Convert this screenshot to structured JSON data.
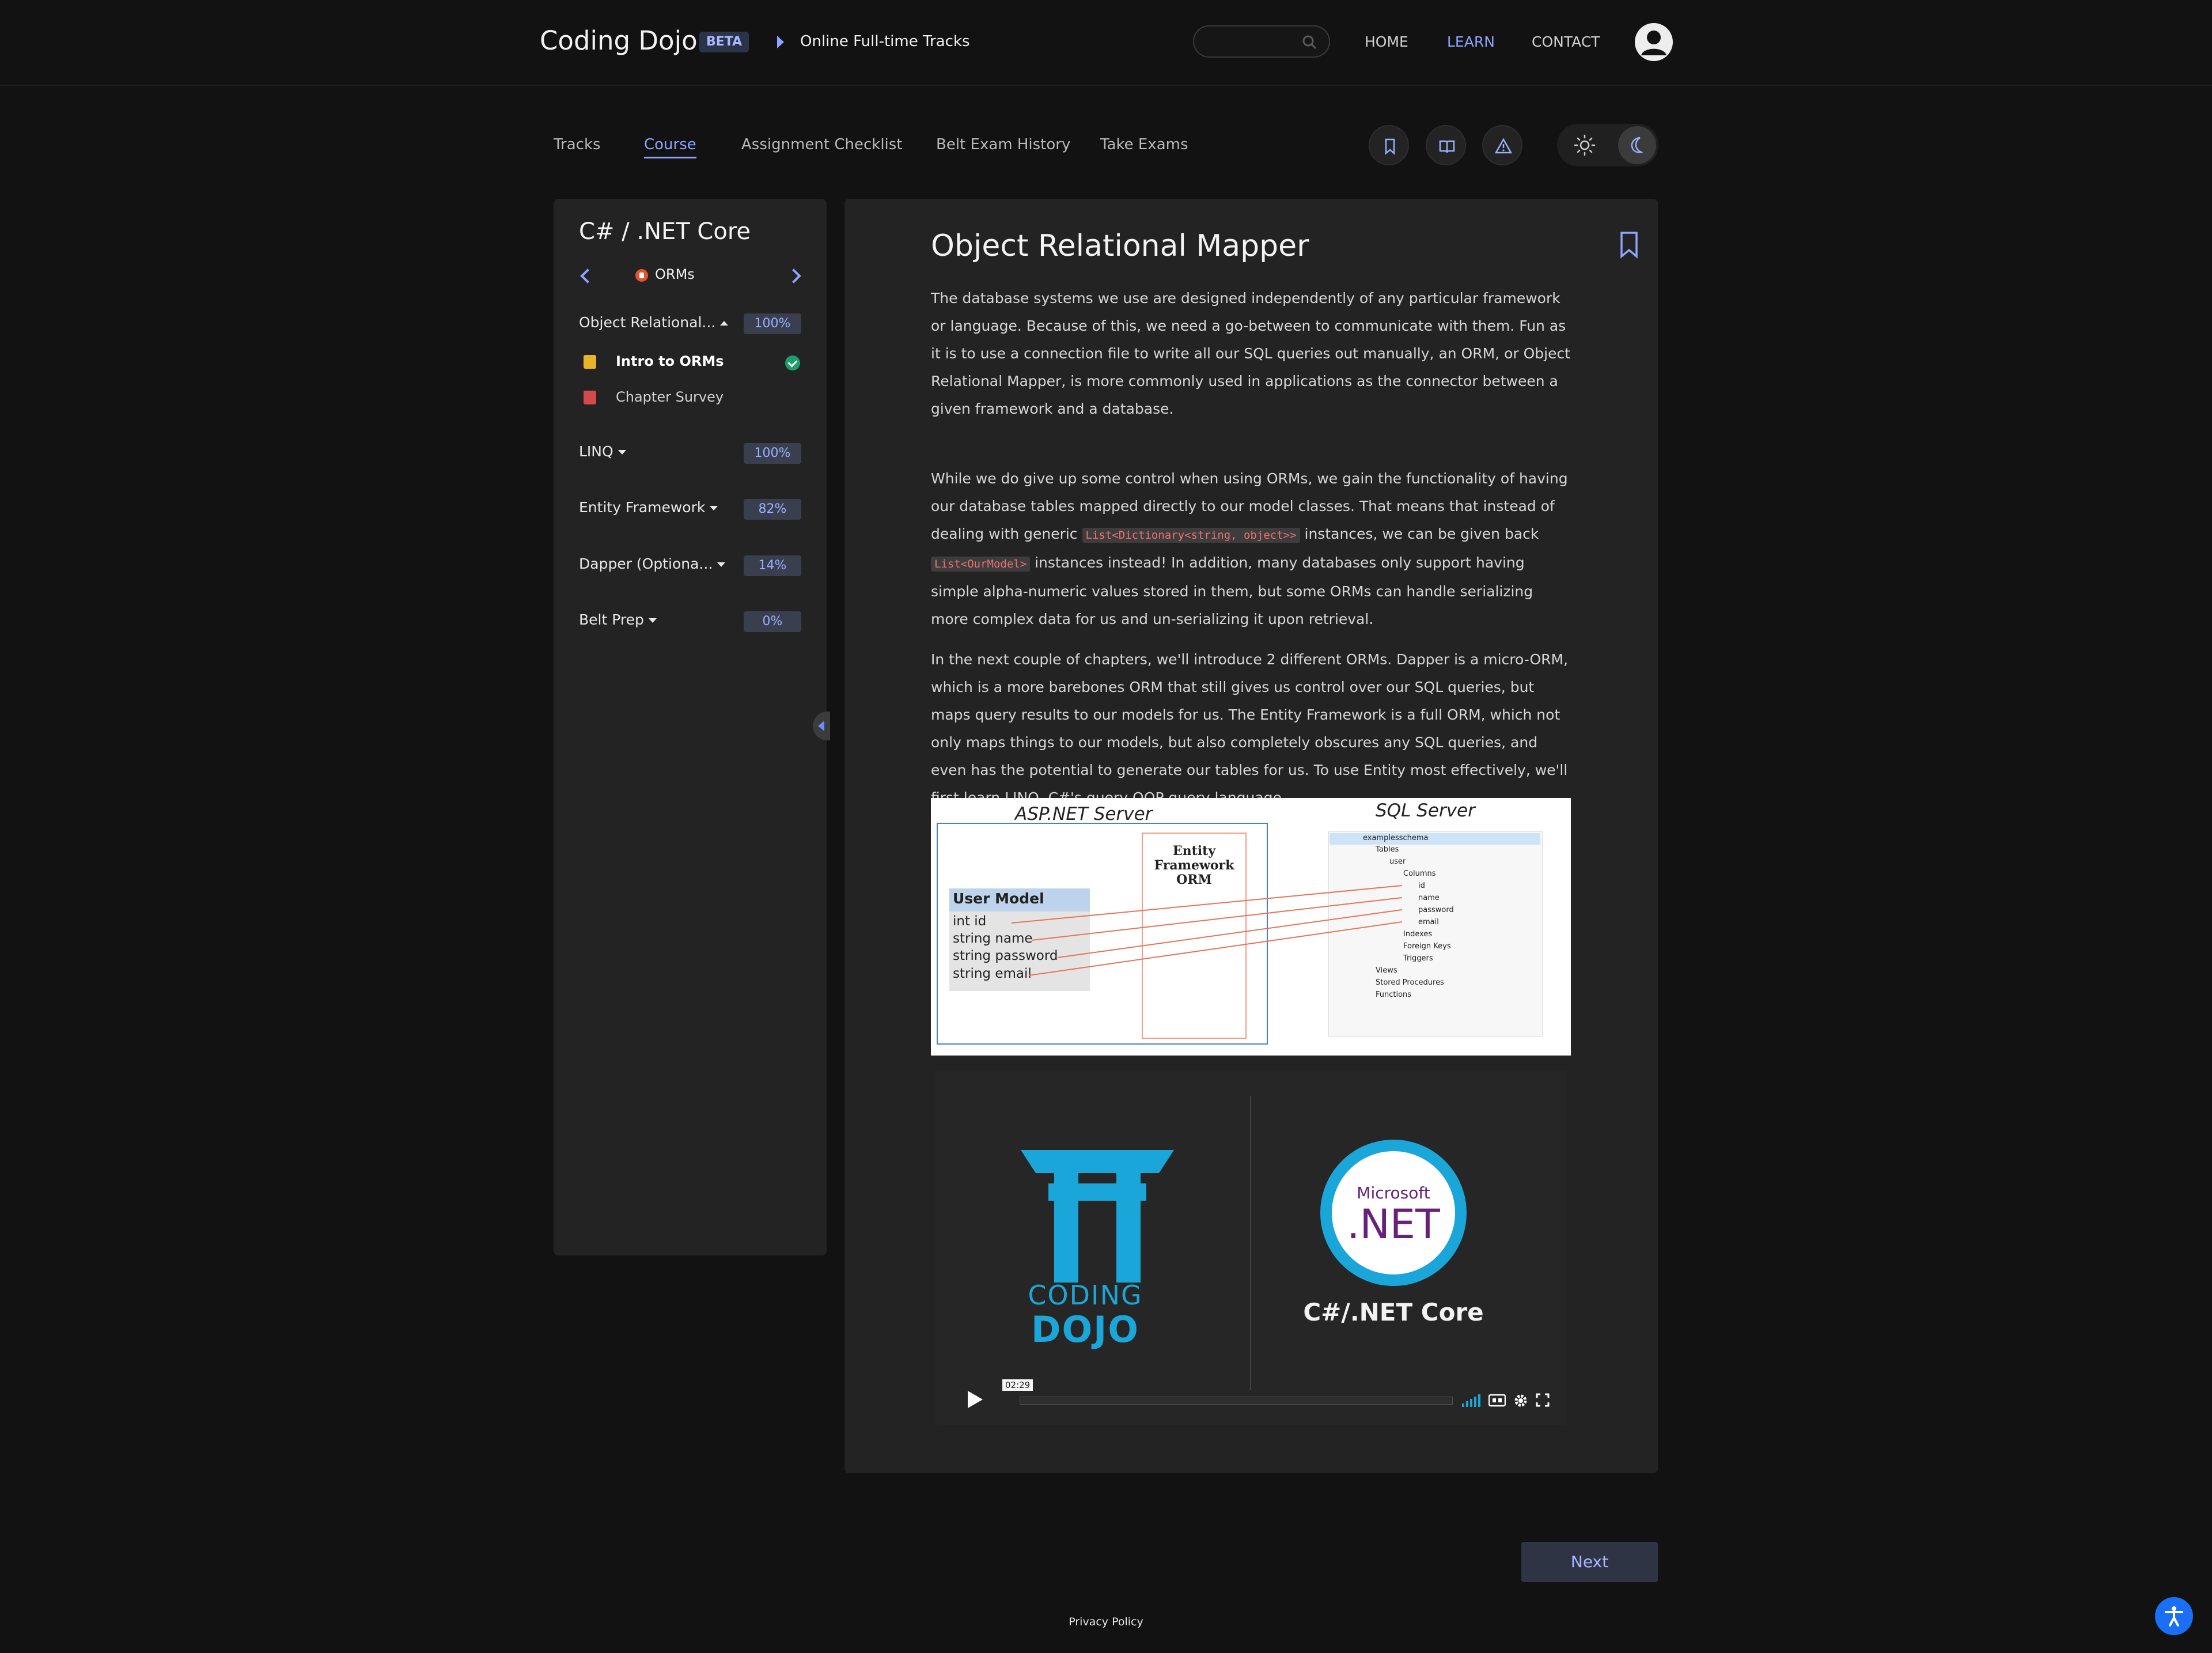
{
  "header": {
    "brand": "Coding Dojo",
    "badge": "BETA",
    "breadcrumb": "Online Full-time Tracks",
    "nav": [
      "HOME",
      "LEARN",
      "CONTACT"
    ],
    "nav_active": "LEARN"
  },
  "tabs": {
    "items": [
      "Tracks",
      "Course",
      "Assignment Checklist",
      "Belt Exam History",
      "Take Exams"
    ],
    "active": "Course"
  },
  "toolbar": {
    "icons": [
      "bookmark-icon",
      "book-icon",
      "warning-icon"
    ],
    "theme_icons": [
      "sun-icon",
      "moon-icon"
    ],
    "theme_active": "dark"
  },
  "sidebar": {
    "course_title": "C# / .NET Core",
    "module": "ORMs",
    "sections": [
      {
        "label": "Object Relational...",
        "percent": "100%",
        "expanded": true
      },
      {
        "label": "LINQ",
        "percent": "100%"
      },
      {
        "label": "Entity Framework",
        "percent": "82%"
      },
      {
        "label": "Dapper (Optiona...",
        "percent": "14%"
      },
      {
        "label": "Belt Prep",
        "percent": "0%"
      }
    ],
    "lessons": [
      {
        "label": "Intro to ORMs",
        "current": true,
        "completed": true
      },
      {
        "label": "Chapter Survey"
      }
    ]
  },
  "content": {
    "title": "Object Relational Mapper",
    "p1": "The database systems we use are designed independently of any particular framework or language. Because of this, we need a go-between to communicate with them. Fun as it is to use a connection file to write all our SQL queries out manually, an ORM, or Object Relational Mapper, is more commonly used in applications as the connector between a given framework and a database.",
    "p2": {
      "a": "While we do give up some control when using ORMs, we gain the functionality of having our database tables mapped directly to our model classes. That means that instead of dealing with generic",
      "code1": "List<Dictionary<string, object>>",
      "b": "instances, we can be given back",
      "code2": "List<OurModel>",
      "c": "instances instead! In addition, many databases only support having simple alpha-numeric values stored in them, but some ORMs can handle serializing more complex data for us and un-serializing it upon retrieval."
    },
    "p3": "In the next couple of chapters, we'll introduce 2 different ORMs. Dapper is a micro-ORM, which is a more barebones ORM that still gives us control over our SQL queries, but maps query results to our models for us. The Entity Framework is a full ORM, which not only maps things to our models, but also completely obscures any SQL queries, and even has the potential to generate our tables for us. To use Entity most effectively, we'll first learn LINQ, C#'s query OOP query language."
  },
  "diagram": {
    "left_title": "ASP.NET Server",
    "right_title": "SQL Server",
    "orm_label": [
      "Entity",
      "Framework",
      "ORM"
    ],
    "model_title": "User Model",
    "model_fields": [
      "int id",
      "string name",
      "string password",
      "string email"
    ],
    "tree": [
      "examplesschema",
      "Tables",
      "user",
      "Columns",
      "id",
      "name",
      "password",
      "email",
      "Indexes",
      "Foreign Keys",
      "Triggers",
      "Views",
      "Stored Procedures",
      "Functions"
    ]
  },
  "video": {
    "logo_line1": "CODING",
    "logo_line2": "DOJO",
    "net_small": "Microsoft",
    "net_big": ".NET",
    "caption": "C#/.NET Core",
    "time": "02:29"
  },
  "footer": {
    "next": "Next",
    "privacy": "Privacy Policy"
  },
  "colors": {
    "accent": "#8ea4ff",
    "background": "#121212",
    "panel": "#232323",
    "code_text": "#f07070",
    "dojo_blue": "#1aa6d8",
    "dotnet_purple": "#68217a",
    "check_green": "#1f9e6b"
  }
}
